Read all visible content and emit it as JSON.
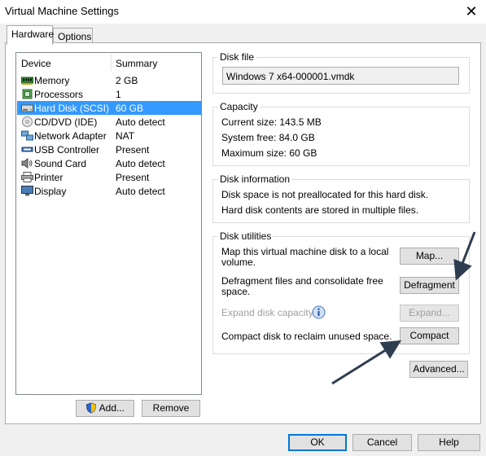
{
  "window": {
    "title": "Virtual Machine Settings"
  },
  "tabs": [
    {
      "label": "Hardware"
    },
    {
      "label": "Options"
    }
  ],
  "devices": {
    "header_device": "Device",
    "header_summary": "Summary",
    "items": [
      {
        "name": "Memory",
        "summary": "2 GB",
        "icon": "memory-icon"
      },
      {
        "name": "Processors",
        "summary": "1",
        "icon": "processor-icon"
      },
      {
        "name": "Hard Disk (SCSI)",
        "summary": "60 GB",
        "icon": "hard-disk-icon"
      },
      {
        "name": "CD/DVD (IDE)",
        "summary": "Auto detect",
        "icon": "cd-dvd-icon"
      },
      {
        "name": "Network Adapter",
        "summary": "NAT",
        "icon": "network-adapter-icon"
      },
      {
        "name": "USB Controller",
        "summary": "Present",
        "icon": "usb-controller-icon"
      },
      {
        "name": "Sound Card",
        "summary": "Auto detect",
        "icon": "sound-card-icon"
      },
      {
        "name": "Printer",
        "summary": "Present",
        "icon": "printer-icon"
      },
      {
        "name": "Display",
        "summary": "Auto detect",
        "icon": "display-icon"
      }
    ],
    "add_label": "Add...",
    "remove_label": "Remove"
  },
  "disk_file": {
    "label": "Disk file",
    "value": "Windows 7 x64-000001.vmdk"
  },
  "capacity": {
    "label": "Capacity",
    "current": "Current size:  143.5 MB",
    "system_free": "System free:  84.0 GB",
    "maximum": "Maximum size:  60 GB"
  },
  "disk_info": {
    "label": "Disk information",
    "line1": "Disk space is not preallocated for this hard disk.",
    "line2": "Hard disk contents are stored in multiple files."
  },
  "disk_utilities": {
    "label": "Disk utilities",
    "map_text_1": "Map this virtual machine disk to a local",
    "map_text_2": "volume.",
    "map_button": "Map...",
    "defrag_text_1": "Defragment files and consolidate free",
    "defrag_text_2": "space.",
    "defrag_button": "Defragment",
    "expand_text": "Expand disk capacity.",
    "expand_button": "Expand...",
    "compact_text": "Compact disk to reclaim unused space.",
    "compact_button": "Compact"
  },
  "advanced_button": "Advanced...",
  "footer": {
    "ok": "OK",
    "cancel": "Cancel",
    "help": "Help"
  },
  "colors": {
    "selection": "#3399ff",
    "arrow": "#2f3d50",
    "accent": "#0078d7"
  }
}
